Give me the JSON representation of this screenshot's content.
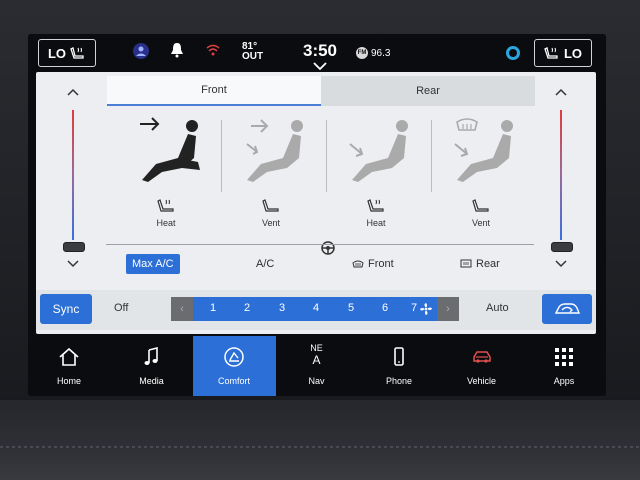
{
  "status": {
    "left_seat_level": "LO",
    "right_seat_level": "LO",
    "outside_temp": "81°",
    "outside_label": "OUT",
    "clock": "3:50",
    "radio_band": "FM",
    "radio_freq": "96.3"
  },
  "climate": {
    "tabs": [
      {
        "label": "Front",
        "active": true
      },
      {
        "label": "Rear",
        "active": false
      }
    ],
    "modes": [
      {
        "label": "Heat",
        "icon": "seat-heat-icon"
      },
      {
        "label": "Vent",
        "icon": "seat-vent-icon"
      },
      {
        "label": "Heat",
        "icon": "seat-heat-icon"
      },
      {
        "label": "Vent",
        "icon": "seat-vent-icon"
      }
    ],
    "ac_buttons": {
      "max_ac": "Max A/C",
      "ac": "A/C",
      "front_defrost": "Front",
      "rear_defrost": "Rear"
    },
    "fan": {
      "sync": "Sync",
      "off": "Off",
      "speeds": [
        "1",
        "2",
        "3",
        "4",
        "5",
        "6",
        "7"
      ],
      "current_speed": 7,
      "auto": "Auto"
    }
  },
  "nav": [
    {
      "label": "Home",
      "icon": "home-icon"
    },
    {
      "label": "Media",
      "icon": "music-note-icon"
    },
    {
      "label": "Comfort",
      "icon": "comfort-icon",
      "active": true
    },
    {
      "label": "Nav",
      "icon": "compass-icon",
      "heading": "NE",
      "heading_sub": "A"
    },
    {
      "label": "Phone",
      "icon": "phone-icon"
    },
    {
      "label": "Vehicle",
      "icon": "car-icon"
    },
    {
      "label": "Apps",
      "icon": "apps-grid-icon"
    }
  ],
  "colors": {
    "accent": "#2c6fd6",
    "panel": "#eceef1",
    "background": "#0b0c0f"
  }
}
